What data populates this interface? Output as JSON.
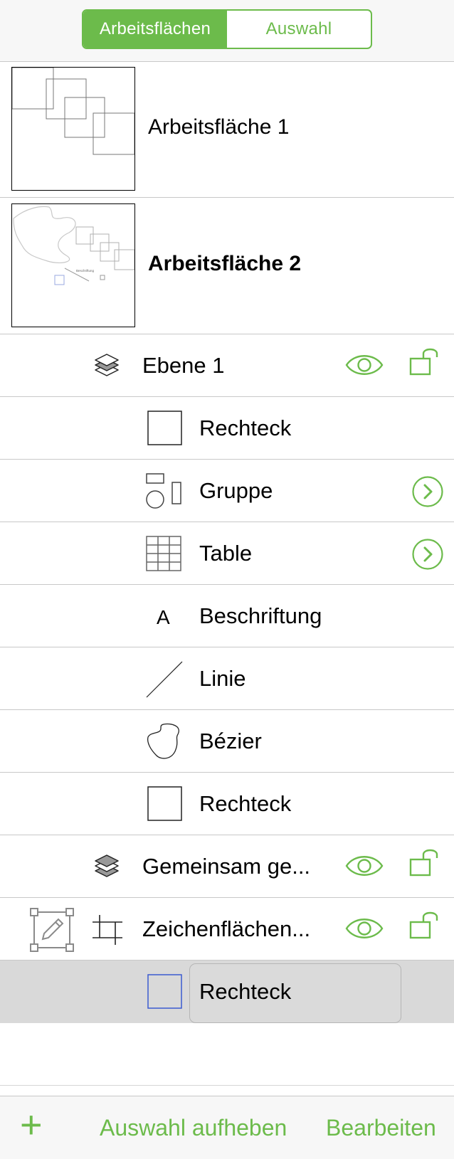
{
  "segmented": {
    "tabs": [
      {
        "label": "Arbeitsflächen",
        "selected": true
      },
      {
        "label": "Auswahl",
        "selected": false
      }
    ]
  },
  "artboards": [
    {
      "label": "Arbeitsfläche 1",
      "bold": false
    },
    {
      "label": "Arbeitsfläche 2",
      "bold": true,
      "thumb_text": "Beschriftung"
    }
  ],
  "layers": {
    "ebene1": {
      "label": "Ebene 1"
    },
    "items": [
      {
        "label": "Rechteck",
        "icon": "rectangle-icon"
      },
      {
        "label": "Gruppe",
        "icon": "group-icon",
        "has_disclosure": true
      },
      {
        "label": "Table",
        "icon": "table-icon",
        "has_disclosure": true
      },
      {
        "label": "Beschriftung",
        "icon": "text-icon",
        "icon_glyph": "A"
      },
      {
        "label": "Linie",
        "icon": "line-icon"
      },
      {
        "label": "Bézier",
        "icon": "bezier-icon"
      },
      {
        "label": "Rechteck",
        "icon": "rectangle-icon"
      }
    ],
    "shared": {
      "label": "Gemeinsam ge..."
    },
    "canvas": {
      "label": "Zeichenflächen..."
    },
    "selected_item": {
      "label": "Rechteck",
      "icon": "rectangle-icon"
    }
  },
  "toolbar": {
    "add_glyph": "+",
    "deselect_label": "Auswahl aufheben",
    "edit_label": "Bearbeiten"
  },
  "colors": {
    "accent": "#6cbb4b",
    "selection": "#d9d9d9",
    "selected_rect_stroke": "#3b5bd0"
  }
}
